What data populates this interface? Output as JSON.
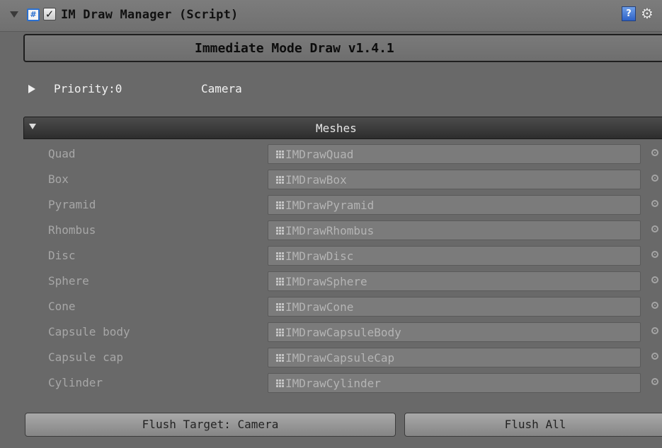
{
  "header": {
    "script_icon_glyph": "#",
    "checkbox_glyph": "✓",
    "title": "IM Draw Manager (Script)",
    "help_glyph": "?",
    "settings_glyph": "⚙"
  },
  "inspector": {
    "title": "Immediate Mode Draw v1.4.1",
    "priority_label": "Priority:0",
    "camera_label": "Camera"
  },
  "meshes": {
    "title": "Meshes",
    "items": [
      {
        "label": "Quad",
        "value": "IMDrawQuad"
      },
      {
        "label": "Box",
        "value": "IMDrawBox"
      },
      {
        "label": "Pyramid",
        "value": "IMDrawPyramid"
      },
      {
        "label": "Rhombus",
        "value": "IMDrawRhombus"
      },
      {
        "label": "Disc",
        "value": "IMDrawDisc"
      },
      {
        "label": "Sphere",
        "value": "IMDrawSphere"
      },
      {
        "label": "Cone",
        "value": "IMDrawCone"
      },
      {
        "label": "Capsule body",
        "value": "IMDrawCapsuleBody"
      },
      {
        "label": "Capsule cap",
        "value": "IMDrawCapsuleCap"
      },
      {
        "label": "Cylinder",
        "value": "IMDrawCylinder"
      }
    ]
  },
  "buttons": {
    "flush_target": "Flush Target: Camera",
    "flush_all": "Flush All"
  },
  "icons": {
    "foldout": "triangle-down-icon",
    "script": "csharp-script-icon",
    "help": "help-book-icon",
    "settings": "gear-icon",
    "mesh": "mesh-icon",
    "picker": "object-picker-icon"
  }
}
